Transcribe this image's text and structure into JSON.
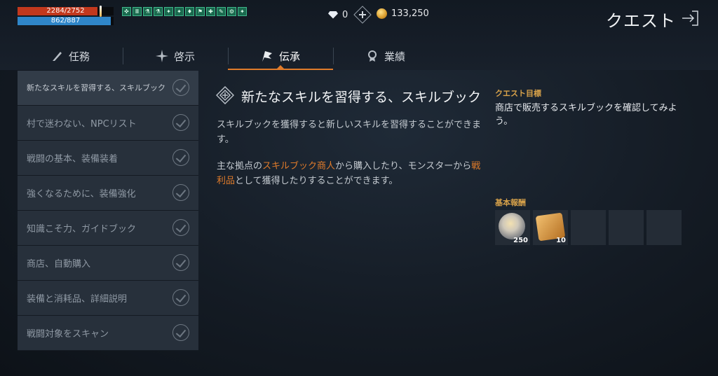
{
  "status": {
    "hp": "2284/2752",
    "hp_ratio": 0.83,
    "mp": "862/887",
    "mp_ratio": 0.97
  },
  "buffs": [
    "✜",
    "Ⅲ",
    "⚗",
    "⚗",
    "✦",
    "✦",
    "♦",
    "⚑",
    "✚",
    "✎",
    "⚙",
    "✦"
  ],
  "currency": {
    "diamond": "0",
    "gold": "133,250"
  },
  "header": {
    "title": "クエスト",
    "exit_icon": "exit-icon"
  },
  "tabs": [
    {
      "label": "任務",
      "icon": "quill-icon"
    },
    {
      "label": "啓示",
      "icon": "star-burst-icon"
    },
    {
      "label": "伝承",
      "icon": "flag-icon",
      "active": true
    },
    {
      "label": "業績",
      "icon": "medal-icon"
    }
  ],
  "quests": [
    "新たなスキルを習得する、スキルブック",
    "村で迷わない、NPCリスト",
    "戦闘の基本、装備装着",
    "強くなるために、装備強化",
    "知識こそ力、ガイドブック",
    "商店、自動購入",
    "装備と消耗品、詳細説明",
    "戦闘対象をスキャン"
  ],
  "detail": {
    "title": "新たなスキルを習得する、スキルブック",
    "p1": "スキルブックを獲得すると新しいスキルを習得することができます。",
    "p2_a": "主な拠点の",
    "p2_hl1": "スキルブック商人",
    "p2_b": "から購入したり、モンスターから",
    "p2_hl2": "戦利品",
    "p2_c": "として獲得したりすることができます。"
  },
  "objective": {
    "heading": "クエスト目標",
    "text": "商店で販売するスキルブックを確認してみよう。"
  },
  "rewards": {
    "heading": "基本報酬",
    "items": [
      {
        "icon": "silver-coin-icon",
        "count": "250"
      },
      {
        "icon": "scroll-icon",
        "count": "10"
      }
    ]
  },
  "colors": {
    "accent": "#e07b2a",
    "hp": "#c2381d",
    "mp": "#2f86c9"
  }
}
